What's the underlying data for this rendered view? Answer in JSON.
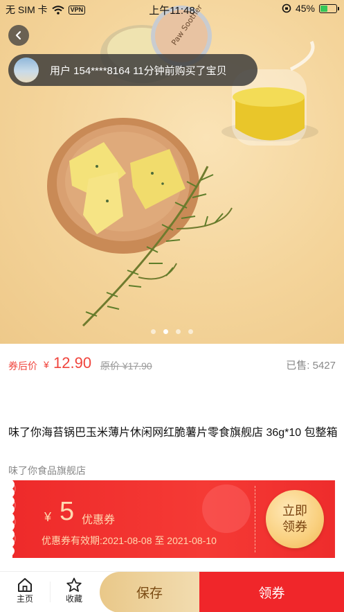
{
  "status_bar": {
    "carrier": "无 SIM 卡",
    "vpn": "VPN",
    "time": "上午11:48",
    "battery": "45%",
    "battery_level": 0.45
  },
  "hero": {
    "notice": "用户 154****8164 11分钟前购买了宝贝",
    "page_count": 4,
    "active_page": 2
  },
  "price": {
    "after_coupon_label": "券后价",
    "currency": "¥",
    "value": "12.90",
    "original": "原价 ¥17.90",
    "sold": "已售: 5427"
  },
  "product": {
    "title": "味了你海苔锅巴玉米薄片休闲网红脆薯片零食旗舰店 36g*10 包整箱",
    "shop": "味了你食品旗舰店"
  },
  "coupon": {
    "currency": "¥",
    "amount": "5",
    "label": "优惠券",
    "validity": "优惠券有效期:2021-08-08 至 2021-08-10",
    "claim_line1": "立即",
    "claim_line2": "领券"
  },
  "bottom_bar": {
    "home_label": "主页",
    "fav_label": "收藏",
    "save_label": "保存",
    "claim_label": "领券"
  },
  "colors": {
    "accent_red": "#f0262a",
    "price_red": "#f0443c",
    "gold": "#e9c889"
  }
}
